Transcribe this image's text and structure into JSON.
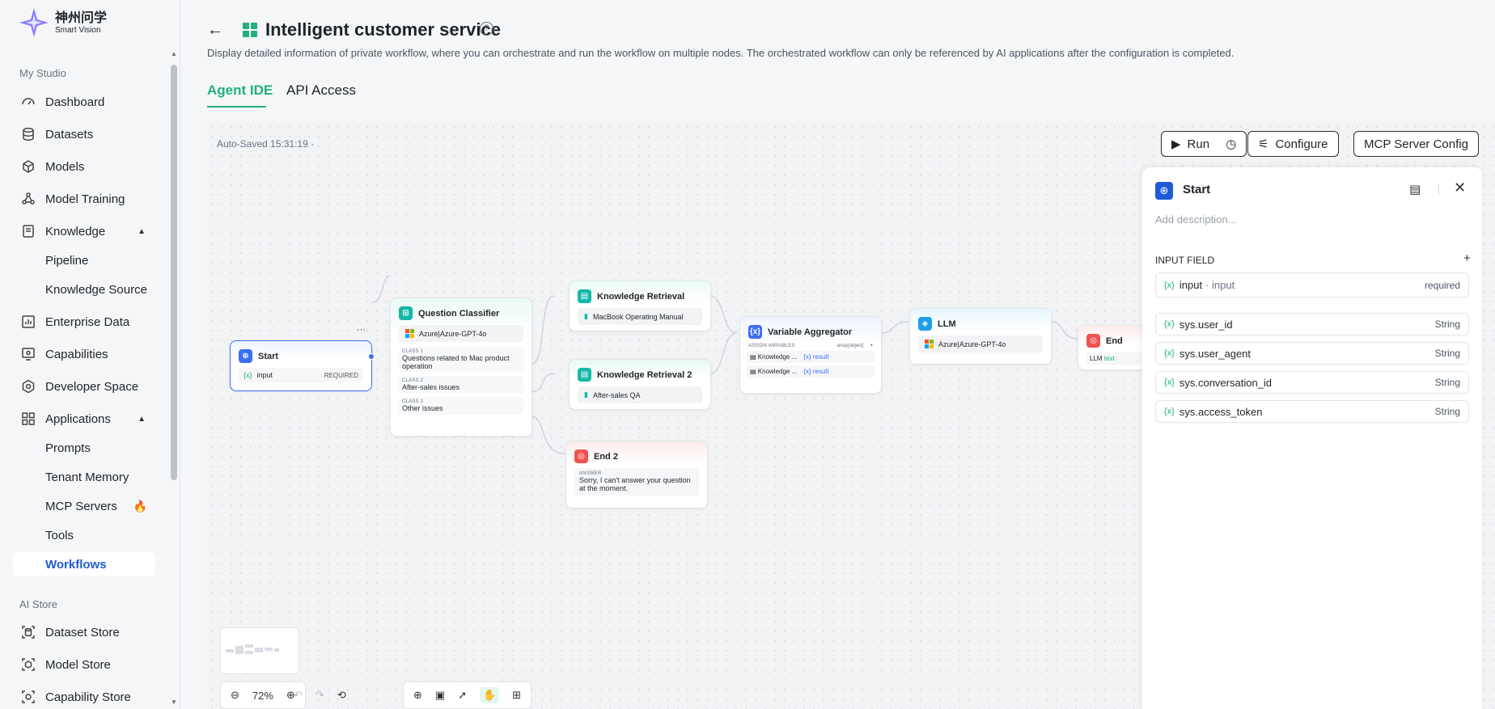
{
  "brand": {
    "name_cn": "神州问学",
    "name_en": "Smart Vision"
  },
  "sidebar": {
    "sections": [
      {
        "title": "My Studio"
      },
      {
        "title": "AI Store"
      }
    ],
    "items": [
      {
        "label": "Dashboard"
      },
      {
        "label": "Datasets"
      },
      {
        "label": "Models"
      },
      {
        "label": "Model Training"
      },
      {
        "label": "Knowledge"
      },
      {
        "label": "Pipeline"
      },
      {
        "label": "Knowledge Source"
      },
      {
        "label": "Enterprise Data"
      },
      {
        "label": "Capabilities"
      },
      {
        "label": "Developer Space"
      },
      {
        "label": "Applications"
      },
      {
        "label": "Prompts"
      },
      {
        "label": "Tenant Memory"
      },
      {
        "label": "MCP Servers"
      },
      {
        "label": "Tools"
      },
      {
        "label": "Workflows"
      },
      {
        "label": "Dataset Store"
      },
      {
        "label": "Model Store"
      },
      {
        "label": "Capability Store"
      }
    ]
  },
  "header": {
    "title": "Intelligent customer service",
    "description": "Display detailed information of private workflow, where you can orchestrate and run the workflow on multiple nodes. The orchestrated workflow can only be referenced by AI applications after the configuration is completed.",
    "tabs": [
      {
        "label": "Agent IDE"
      },
      {
        "label": "API Access"
      }
    ]
  },
  "canvas": {
    "autosaved": "Auto-Saved 15:31:19 ·",
    "buttons": {
      "run": "Run",
      "configure": "Configure",
      "mcp": "MCP Server Config"
    },
    "zoom": "72%",
    "nodes": {
      "start": {
        "title": "Start",
        "var": "input",
        "req": "REQUIRED",
        "more": "···"
      },
      "classifier": {
        "title": "Question Classifier",
        "model": "Azure|Azure-GPT-4o",
        "classes": [
          {
            "label": "CLASS 1",
            "text": "Questions related to Mac product operation"
          },
          {
            "label": "CLASS 2",
            "text": "After-sales issues"
          },
          {
            "label": "CLASS 3",
            "text": "Other issues"
          }
        ]
      },
      "kr1": {
        "title": "Knowledge Retrieval",
        "source": "MacBook Operating Manual"
      },
      "kr2": {
        "title": "Knowledge Retrieval 2",
        "source": "After-sales QA"
      },
      "end2": {
        "title": "End 2",
        "label": "ANSWER",
        "text": "Sorry, I can't answer your question at the moment."
      },
      "agg": {
        "title": "Variable Aggregator",
        "label": "ASSIGN VARIABLES",
        "type": "array[object]",
        "plus": "+",
        "rows": [
          {
            "name": "Knowledge ...",
            "val": "result"
          },
          {
            "name": "Knowledge ...",
            "val": "result"
          }
        ]
      },
      "llm": {
        "title": "LLM",
        "model": "Azure|Azure-GPT-4o"
      },
      "end": {
        "title": "End",
        "out": "LLM",
        "out2": "text"
      }
    }
  },
  "panel": {
    "title": "Start",
    "add_description": "Add description...",
    "section": "INPUT FIELD",
    "plus": "+",
    "fields": [
      {
        "name": "input",
        "alias": "· input",
        "type": "required"
      },
      {
        "name": "sys.user_id",
        "type": "String"
      },
      {
        "name": "sys.user_agent",
        "type": "String"
      },
      {
        "name": "sys.conversation_id",
        "type": "String"
      },
      {
        "name": "sys.access_token",
        "type": "String"
      }
    ]
  },
  "colors": {
    "accent": "#22b07d",
    "blue": "#3b6ef5"
  }
}
